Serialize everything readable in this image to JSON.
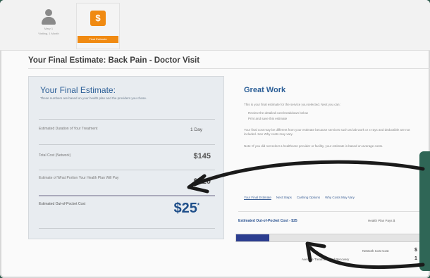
{
  "steps": {
    "person": {
      "name_line": "Mary 1",
      "sub_line": "Visiting, 1 Month"
    },
    "final": {
      "label": "Final Estimate",
      "icon": "dollar-icon"
    }
  },
  "page": {
    "title": "Your Final Estimate:   Back Pain - Doctor Visit"
  },
  "estimate": {
    "heading": "Your Final Estimate:",
    "note": "These numbers are based on your health plan and the providers you chose.",
    "rows": [
      {
        "label": "Estimated Duration of Your Treatment",
        "value": "1 Day"
      },
      {
        "label": "Total Cost (Network)",
        "value": "$145"
      },
      {
        "label": "Estimate of What Portion Your Health Plan Will Pay",
        "value": "$120"
      }
    ],
    "oop": {
      "label": "Estimated Out-of-Pocket Cost",
      "value": "$25",
      "mark": "*"
    }
  },
  "info": {
    "heading": "Great Work",
    "p1": "This is your final estimate for the service you selected. Next you can:",
    "b1": "Review the detailed cost breakdown below",
    "b2": "Print and save this estimate",
    "p2": "Your final cost may be different from your estimate because services such as lab work or x-rays and deductible are not included. See Why costs may vary.",
    "p3": "Note: If you did not select a healthcare provider or facility, your estimate is based on average costs.",
    "links": [
      "Your Final Estimate",
      "Next Steps",
      "Cashing Options",
      "Why Costs May Vary"
    ]
  },
  "breakdown": {
    "oop_label": "Estimated Out-of-Pocket Cost - $25",
    "hp_label": "Health Plan Pays $",
    "progress": 0.17,
    "net_label": "Network Cost Cost",
    "net_value": "$",
    "avg_label": "Average Treatment and Recovery",
    "avg_value": "1"
  },
  "colors": {
    "accent": "#2c5f97",
    "orange": "#f08a12",
    "bar": "#2b3d8f",
    "overlay": "#2f6656"
  }
}
